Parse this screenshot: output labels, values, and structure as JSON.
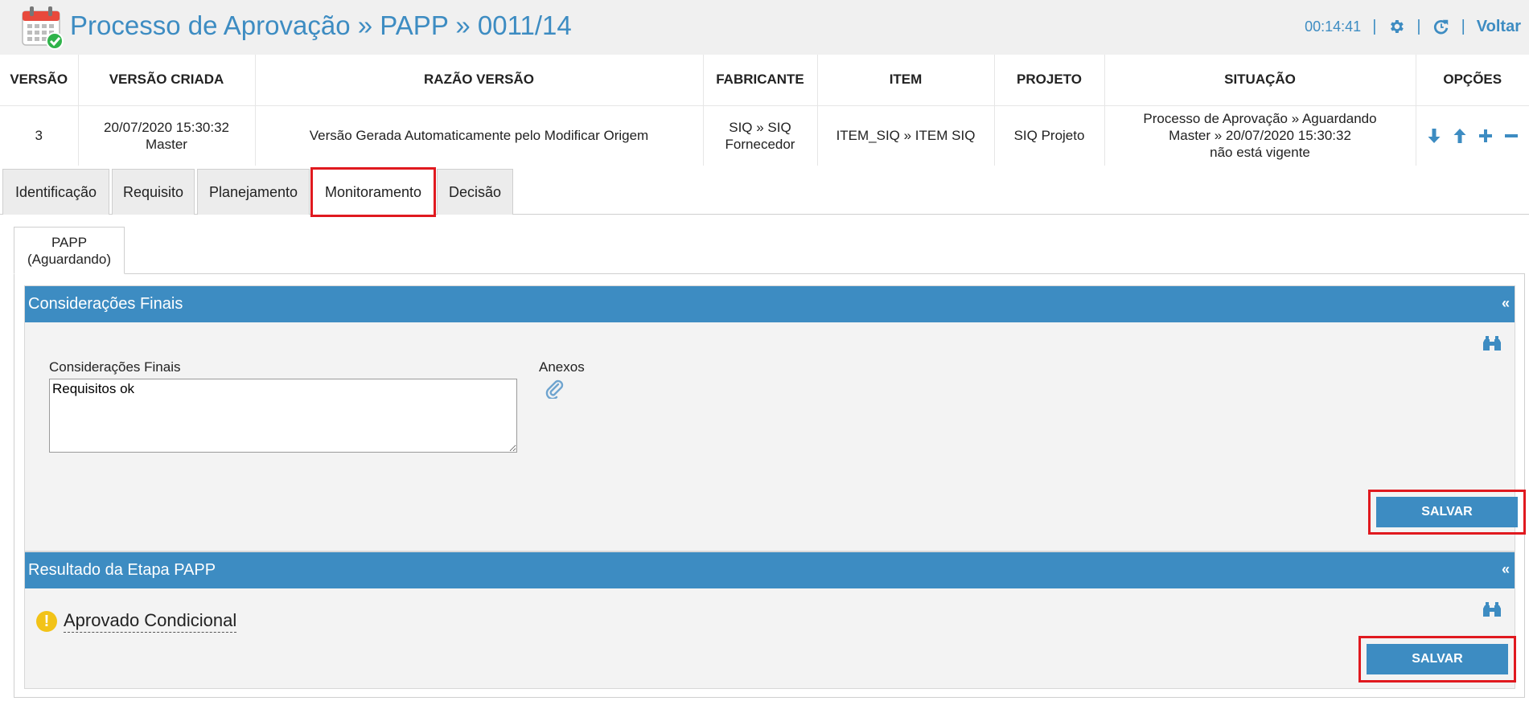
{
  "header": {
    "title": "Processo de Aprovação » PAPP » 0011/14",
    "timer": "00:14:41",
    "separator": "|",
    "back_label": "Voltar",
    "accent_color": "#3d8cc2",
    "icons": [
      "calendar-check-icon",
      "gear-icon",
      "refresh-icon"
    ]
  },
  "version_table": {
    "headers": [
      "VERSÃO",
      "VERSÃO CRIADA",
      "RAZÃO VERSÃO",
      "FABRICANTE",
      "ITEM",
      "PROJETO",
      "SITUAÇÃO",
      "OPÇÕES"
    ],
    "row": {
      "version": "3",
      "created_line1": "20/07/2020 15:30:32",
      "created_line2": "Master",
      "reason": "Versão Gerada Automaticamente pelo Modificar Origem",
      "manufacturer_line1": "SIQ » SIQ",
      "manufacturer_line2": "Fornecedor",
      "item": "ITEM_SIQ » ITEM SIQ",
      "project": "SIQ Projeto",
      "status_line1": "Processo de Aprovação » Aguardando",
      "status_line2": "Master » 20/07/2020 15:30:32",
      "status_line3": "não está vigente"
    },
    "option_icons": [
      "arrow-down-icon",
      "arrow-up-icon",
      "plus-icon",
      "minus-icon"
    ]
  },
  "tabs": [
    {
      "label": "Identificação"
    },
    {
      "label": "Requisito"
    },
    {
      "label": "Planejamento"
    },
    {
      "label": "Monitoramento",
      "active": true
    },
    {
      "label": "Decisão"
    }
  ],
  "subtab": {
    "line1": "PAPP",
    "line2": "(Aguardando)"
  },
  "final_considerations": {
    "section_title": "Considerações Finais",
    "collapse_label": "«",
    "field_label": "Considerações Finais",
    "field_value": "Requisitos ok",
    "attachments_label": "Anexos",
    "save_label": "SALVAR"
  },
  "stage_result": {
    "section_title": "Resultado da Etapa PAPP",
    "collapse_label": "«",
    "warning_glyph": "!",
    "result_text": "Aprovado Condicional",
    "save_label": "SALVAR"
  },
  "colors": {
    "highlight": "#e0191f",
    "section_header": "#3d8cc2",
    "warning": "#f2c318"
  }
}
